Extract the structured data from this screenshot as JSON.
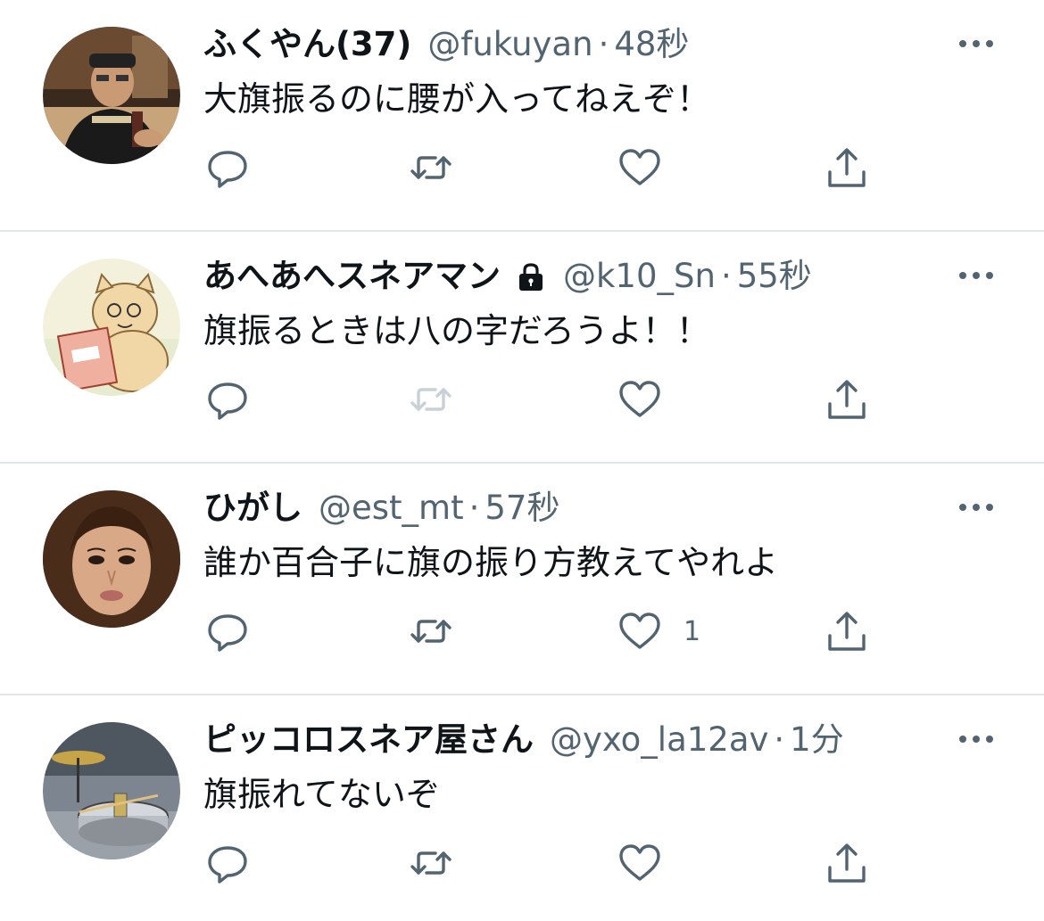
{
  "tweets": [
    {
      "name": "ふくやん(37)",
      "handle": "@fukuyan",
      "separator": "·",
      "time": "48秒",
      "text": "大旗振るのに腰が入ってねえぞ！",
      "protected": false,
      "retweet_disabled": false,
      "like_count": ""
    },
    {
      "name": "あへあへスネアマン",
      "handle": "@k10_Sn",
      "separator": "·",
      "time": "55秒",
      "text": "旗振るときは八の字だろうよ！！",
      "protected": true,
      "retweet_disabled": true,
      "like_count": ""
    },
    {
      "name": "ひがし",
      "handle": "@est_mt",
      "separator": "·",
      "time": "57秒",
      "text": "誰か百合子に旗の振り方教えてやれよ",
      "protected": false,
      "retweet_disabled": false,
      "like_count": "1"
    },
    {
      "name": "ピッコロスネア屋さん",
      "handle": "@yxo_la12av",
      "separator": "·",
      "time": "1分",
      "text": "旗振れてないぞ",
      "protected": false,
      "retweet_disabled": false,
      "like_count": ""
    }
  ],
  "colors": {
    "text": "#0f1419",
    "secondary": "#536471",
    "divider": "#e1e6ea",
    "disabled_icon": "#c9d1d8"
  },
  "icons": [
    "reply-icon",
    "retweet-icon",
    "like-icon",
    "share-icon",
    "more-icon",
    "lock-icon"
  ]
}
